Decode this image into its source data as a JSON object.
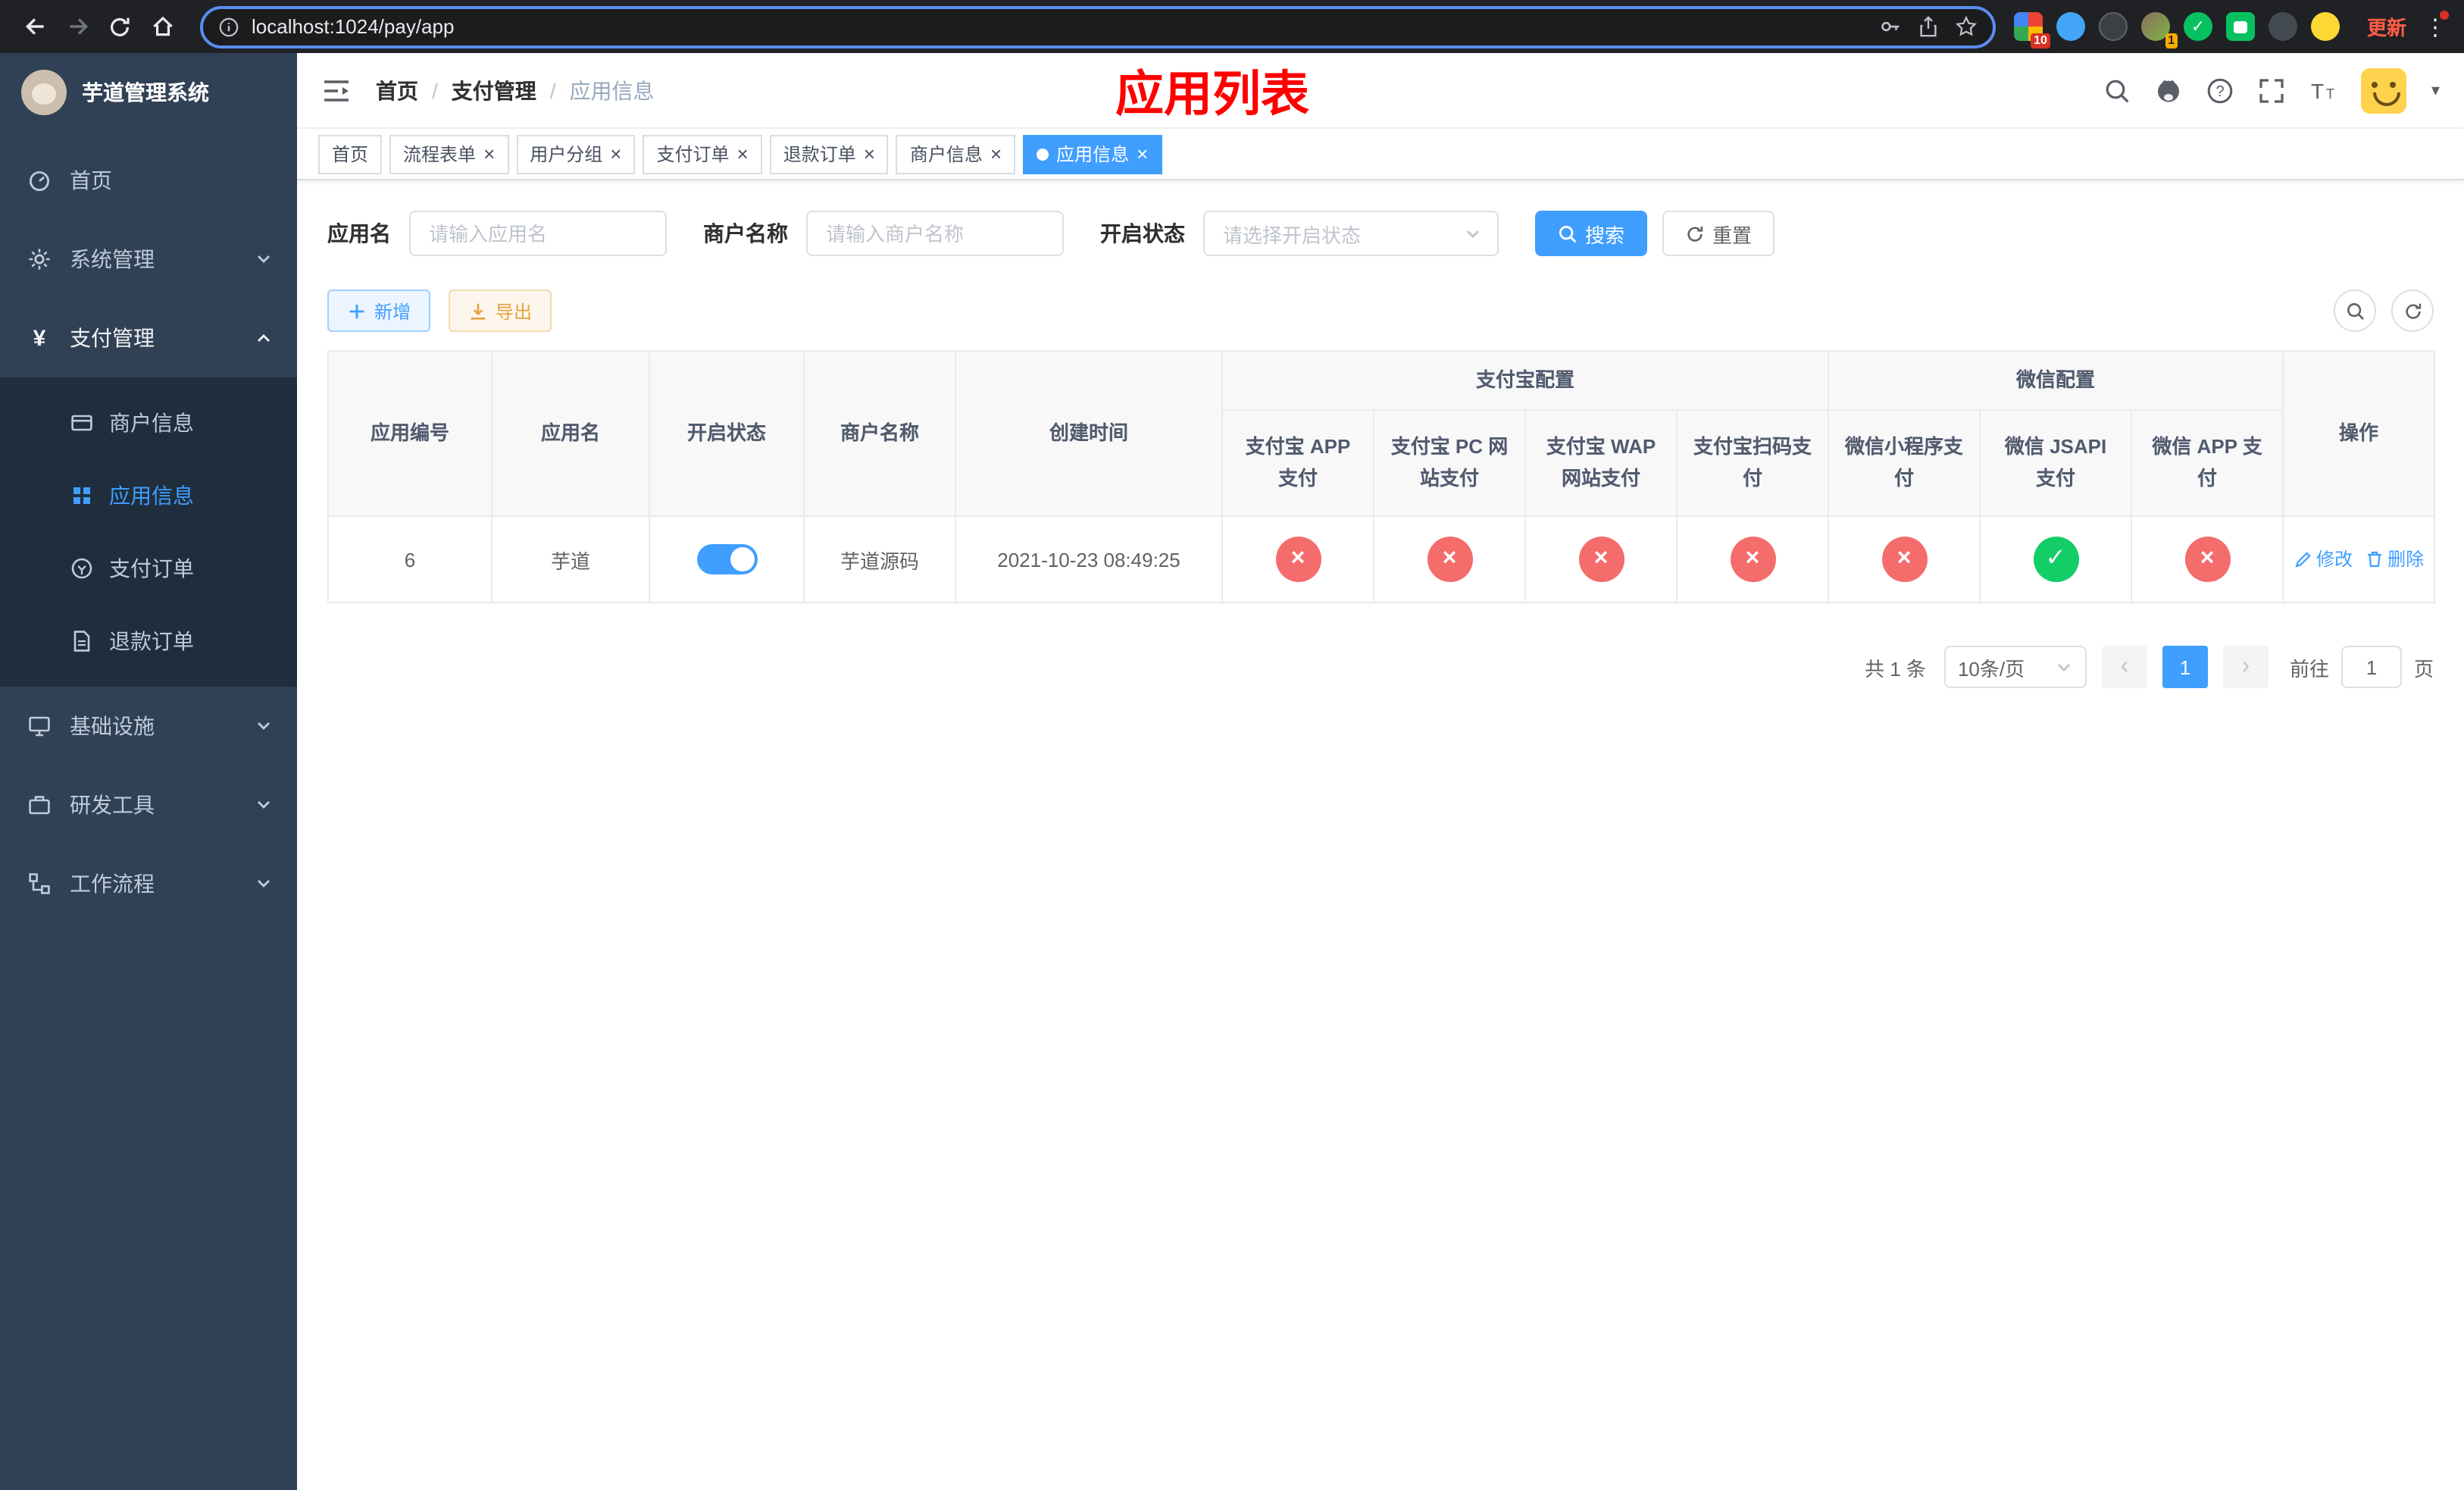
{
  "colors": {
    "primary": "#409eff",
    "danger": "#f56c6c",
    "success": "#13ce66",
    "title_red": "#ff0000"
  },
  "browser": {
    "url": "localhost:1024/pay/app",
    "update_label": "更新",
    "extension_badge_count": "10",
    "profile_badge_count": "1"
  },
  "sidebar": {
    "app_title": "芋道管理系统",
    "menu": [
      {
        "label": "首页"
      },
      {
        "label": "系统管理"
      },
      {
        "label": "支付管理"
      },
      {
        "label": "基础设施"
      },
      {
        "label": "研发工具"
      },
      {
        "label": "工作流程"
      }
    ],
    "payment_submenu": [
      {
        "label": "商户信息"
      },
      {
        "label": "应用信息"
      },
      {
        "label": "支付订单"
      },
      {
        "label": "退款订单"
      }
    ]
  },
  "navbar": {
    "breadcrumb": [
      "首页",
      "支付管理",
      "应用信息"
    ],
    "breadcrumb_separator": "/",
    "page_title": "应用列表"
  },
  "tabs": [
    {
      "label": "首页",
      "closable": false,
      "active": false
    },
    {
      "label": "流程表单",
      "closable": true,
      "active": false
    },
    {
      "label": "用户分组",
      "closable": true,
      "active": false
    },
    {
      "label": "支付订单",
      "closable": true,
      "active": false
    },
    {
      "label": "退款订单",
      "closable": true,
      "active": false
    },
    {
      "label": "商户信息",
      "closable": true,
      "active": false
    },
    {
      "label": "应用信息",
      "closable": true,
      "active": true
    }
  ],
  "filters": {
    "app_name": {
      "label": "应用名",
      "placeholder": "请输入应用名",
      "value": ""
    },
    "merchant_name": {
      "label": "商户名称",
      "placeholder": "请输入商户名称",
      "value": ""
    },
    "status": {
      "label": "开启状态",
      "placeholder": "请选择开启状态",
      "value": ""
    },
    "search_label": "搜索",
    "reset_label": "重置"
  },
  "toolbar": {
    "add_label": "新增",
    "export_label": "导出"
  },
  "table": {
    "group_headers": {
      "alipay": "支付宝配置",
      "wechat": "微信配置"
    },
    "columns": {
      "id": "应用编号",
      "name": "应用名",
      "status": "开启状态",
      "merchant": "商户名称",
      "created": "创建时间",
      "actions": "操作"
    },
    "alipay_columns": [
      "支付宝 APP 支付",
      "支付宝 PC 网站支付",
      "支付宝 WAP 网站支付",
      "支付宝扫码支付"
    ],
    "wechat_columns": [
      "微信小程序支付",
      "微信 JSAPI 支付",
      "微信 APP 支付"
    ],
    "rows": [
      {
        "id": "6",
        "name": "芋道",
        "enabled": true,
        "merchant": "芋道源码",
        "created": "2021-10-23 08:49:25",
        "configs": [
          "x",
          "x",
          "x",
          "x",
          "x",
          "check",
          "x"
        ],
        "edit_label": "修改",
        "delete_label": "删除"
      }
    ]
  },
  "pagination": {
    "total_label": "共 1 条",
    "page_size_label": "10条/页",
    "current_page": "1",
    "jump_prefix": "前往",
    "jump_value": "1",
    "jump_suffix": "页"
  }
}
